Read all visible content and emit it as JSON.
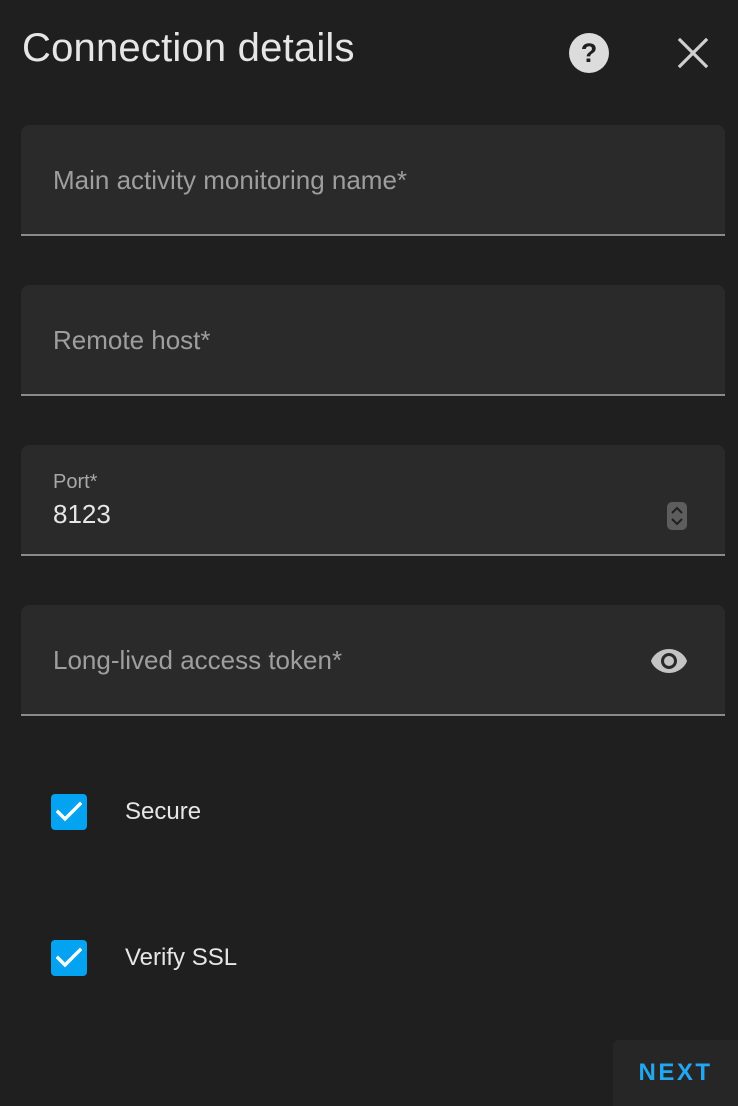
{
  "dialog": {
    "title": "Connection details",
    "help_icon": "help-circle-icon",
    "close_icon": "close-icon"
  },
  "fields": {
    "name": {
      "label": "Main activity monitoring name*",
      "value": ""
    },
    "host": {
      "label": "Remote host*",
      "value": ""
    },
    "port": {
      "label": "Port*",
      "value": "8123",
      "spinner_icon": "stepper-icon"
    },
    "token": {
      "label": "Long-lived access token*",
      "value": "",
      "toggle_icon": "eye-icon"
    }
  },
  "options": {
    "secure": {
      "label": "Secure",
      "checked": true
    },
    "verify_ssl": {
      "label": "Verify SSL",
      "checked": true
    }
  },
  "actions": {
    "next_label": "NEXT"
  },
  "colors": {
    "background": "#1f1f1f",
    "field_bg": "#2a2a2a",
    "accent": "#04a3f1"
  }
}
